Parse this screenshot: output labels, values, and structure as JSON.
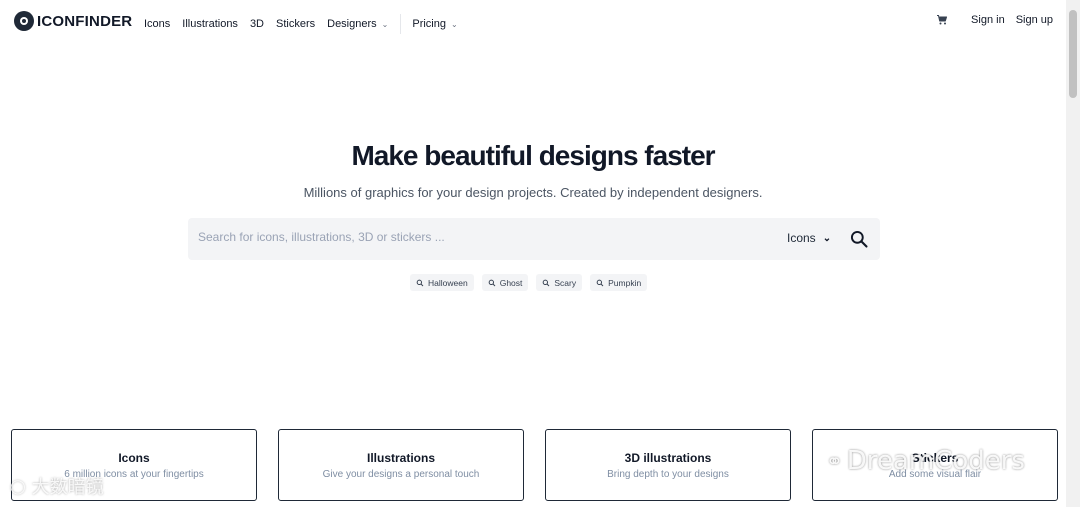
{
  "brand": {
    "name": "ICONFINDER"
  },
  "nav": {
    "links": [
      "Icons",
      "Illustrations",
      "3D",
      "Stickers"
    ],
    "designers": "Designers",
    "pricing": "Pricing",
    "sign_in": "Sign in",
    "sign_up": "Sign up"
  },
  "hero": {
    "headline_pre": "Make",
    "headline_highlight": "beautiful designs",
    "headline_post": "faster",
    "subheadline": "Millions of graphics for your design projects. Created by independent designers."
  },
  "search": {
    "placeholder": "Search for icons, illustrations, 3D or stickers ...",
    "type_selected": "Icons"
  },
  "tags": [
    "Halloween",
    "Ghost",
    "Scary",
    "Pumpkin"
  ],
  "categories": [
    {
      "title": "Icons",
      "subtitle": "6 million icons at your fingertips"
    },
    {
      "title": "Illustrations",
      "subtitle": "Give your designs a personal touch"
    },
    {
      "title": "3D illustrations",
      "subtitle": "Bring depth to your designs"
    },
    {
      "title": "Stickers",
      "subtitle": "Add some visual flair"
    }
  ],
  "watermarks": {
    "left": "大数暗镜",
    "right": "DreamCoders"
  },
  "colors": {
    "highlight": "#fde8b4",
    "text": "#111827",
    "muted": "#7f8ea3",
    "search_bg": "#f3f4f6"
  }
}
